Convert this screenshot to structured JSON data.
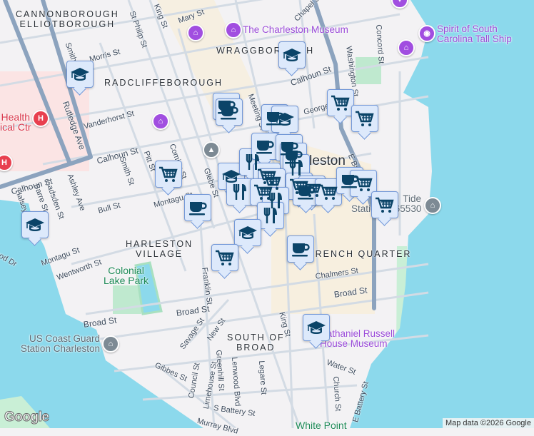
{
  "map": {
    "city_label": "Charleston",
    "neighborhoods": [
      "CANNONBOROUGH\nELLIOTBOROUGH",
      "WRAGGBOROUGH",
      "RADCLIFFEBOROUGH",
      "HARLESTON\nVILLAGE",
      "SOUTH OF\nBROAD",
      "FRENCH QUARTER"
    ],
    "streets": [
      "King St",
      "Mary St",
      "St Philip St",
      "Chapel St",
      "Morris St",
      "Smith St",
      "Rutledge Ave",
      "Vanderhorst St",
      "Calhoun St",
      "Calhoun St",
      "Calhoun St",
      "Smith St",
      "Pitt St",
      "Coming St",
      "Glebe St",
      "Ashley Ave",
      "Barre St",
      "Gadsden St",
      "Halsey",
      "Bull St",
      "Montagu St",
      "Montagu St",
      "Wentworth St",
      "Meeting St",
      "Washington St",
      "Concord St",
      "George St",
      "E Bay St",
      "Chalmers St",
      "Broad St",
      "Broad St",
      "Broad St",
      "Franklin St",
      "Savage St",
      "New St",
      "King St",
      "Gibbes St",
      "Council St",
      "Limehouse St",
      "Greenhill St",
      "Lenwood Blvd",
      "Legare St",
      "S Battery St",
      "Murray Blvd",
      "Water St",
      "Church St",
      "E Battery St",
      "Lockwood Dr"
    ],
    "pois": {
      "museum": "The Charleston Museum",
      "ship": "Spirit of South\nCarolina Tall Ship",
      "hospital": "Health\nical Ctr",
      "tide": "Tide\nStation 8665530",
      "coast_guard": "US Coast Guard\nStation Charleston",
      "russell": "Nathaniel Russell\nHouse Museum",
      "lake": "Colonial\nLake Park",
      "white_point": "White Point"
    },
    "marker_types": [
      "school-icon",
      "cafe-icon",
      "restaurant-icon",
      "grocery-cart-icon"
    ],
    "colors": {
      "water": "#8cd9ec",
      "marker_bg": "#dde9fb",
      "marker_border": "#7398d8",
      "marker_icon": "#0b4468",
      "highway": "#8ca3be",
      "poi": "#9a4ad8"
    }
  },
  "attribution": {
    "logo": "Google",
    "credit": "Map data ©2026 Google"
  }
}
